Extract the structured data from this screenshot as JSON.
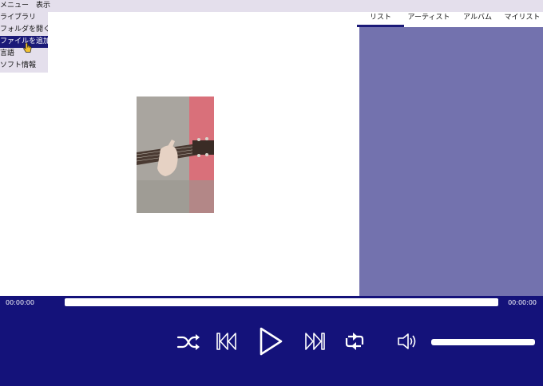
{
  "menubar": {
    "items": [
      {
        "label": "メニュー"
      },
      {
        "label": "表示"
      }
    ]
  },
  "dropdown": {
    "items": [
      {
        "label": "ライブラリ"
      },
      {
        "label": "フォルダを開く"
      },
      {
        "label": "ファイルを追加",
        "selected": true
      },
      {
        "label": "言語"
      },
      {
        "label": "ソフト情報"
      }
    ]
  },
  "tabs": [
    {
      "label": "リスト",
      "active": true
    },
    {
      "label": "アーティスト"
    },
    {
      "label": "アルバム"
    },
    {
      "label": "マイリスト"
    }
  ],
  "player": {
    "current_time": "00:00:00",
    "total_time": "00:00:00",
    "progress": 0,
    "volume": 1.0
  },
  "colors": {
    "menu_bg": "#e4dfec",
    "selection": "#1b1a78",
    "panel": "#7372ae",
    "controlbar": "#14127a"
  },
  "icons": [
    "shuffle-icon",
    "previous-icon",
    "play-icon",
    "next-icon",
    "repeat-icon",
    "volume-icon"
  ]
}
